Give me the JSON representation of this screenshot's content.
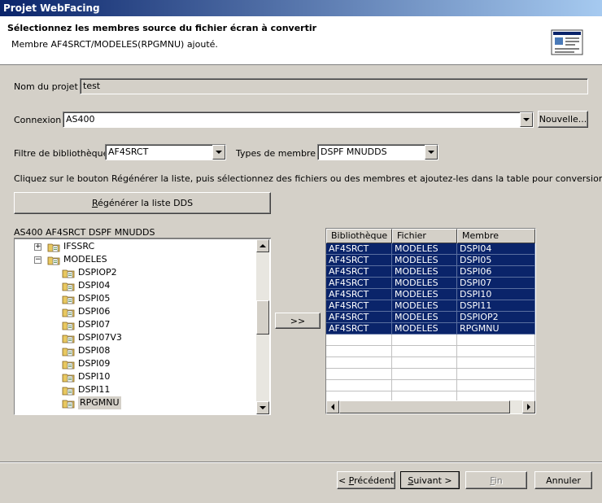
{
  "window": {
    "title": "Projet WebFacing"
  },
  "header": {
    "title": "Sélectionnez les membres source du fichier écran à convertir",
    "message": "Membre AF4SRCT/MODELES(RPGMNU) ajouté.",
    "icon": "wizard-page-icon"
  },
  "project": {
    "label": "Nom du projet :",
    "value": "test"
  },
  "connection": {
    "label": "Connexion :",
    "value": "AS400",
    "new_button": "Nouvelle..."
  },
  "library_filter": {
    "label": "Filtre de bibliothèque :",
    "value": "AF4SRCT"
  },
  "member_types": {
    "label": "Types de membre :",
    "value": "DSPF MNUDDS"
  },
  "instructions": "Cliquez sur le bouton Régénérer la liste, puis sélectionnez des fichiers ou des membres et ajoutez-les dans la table pour conversion :",
  "regen_button": {
    "mnemonic": "R",
    "rest": "égénérer la liste DDS"
  },
  "tree": {
    "header": "AS400 AF4SRCT DSPF MNUDDS",
    "items": [
      {
        "label": "IFSSRC",
        "level": 1,
        "expander": "+"
      },
      {
        "label": "MODELES",
        "level": 1,
        "expander": "−"
      },
      {
        "label": "DSPIOP2",
        "level": 2
      },
      {
        "label": "DSPI04",
        "level": 2
      },
      {
        "label": "DSPI05",
        "level": 2
      },
      {
        "label": "DSPI06",
        "level": 2
      },
      {
        "label": "DSPI07",
        "level": 2
      },
      {
        "label": "DSPI07V3",
        "level": 2
      },
      {
        "label": "DSPI08",
        "level": 2
      },
      {
        "label": "DSPI09",
        "level": 2
      },
      {
        "label": "DSPI10",
        "level": 2
      },
      {
        "label": "DSPI11",
        "level": 2
      },
      {
        "label": "RPGMNU",
        "level": 2,
        "selected": true
      }
    ]
  },
  "add_button": ">>",
  "table": {
    "columns": [
      "Bibliothèque",
      "Fichier",
      "Membre"
    ],
    "rows": [
      [
        "AF4SRCT",
        "MODELES",
        "DSPI04"
      ],
      [
        "AF4SRCT",
        "MODELES",
        "DSPI05"
      ],
      [
        "AF4SRCT",
        "MODELES",
        "DSPI06"
      ],
      [
        "AF4SRCT",
        "MODELES",
        "DSPI07"
      ],
      [
        "AF4SRCT",
        "MODELES",
        "DSPI10"
      ],
      [
        "AF4SRCT",
        "MODELES",
        "DSPI11"
      ],
      [
        "AF4SRCT",
        "MODELES",
        "DSPIOP2"
      ],
      [
        "AF4SRCT",
        "MODELES",
        "RPGMNU"
      ]
    ]
  },
  "footer": {
    "back": {
      "prefix": "< ",
      "mnemonic": "P",
      "rest": "récédent"
    },
    "next": {
      "mnemonic": "S",
      "rest": "uivant >"
    },
    "finish": {
      "mnemonic": "F",
      "rest": "in"
    },
    "cancel": "Annuler"
  },
  "colors": {
    "selection": "#0a246a",
    "dialog": "#d4d0c8",
    "title_gradient_start": "#0a246a"
  }
}
